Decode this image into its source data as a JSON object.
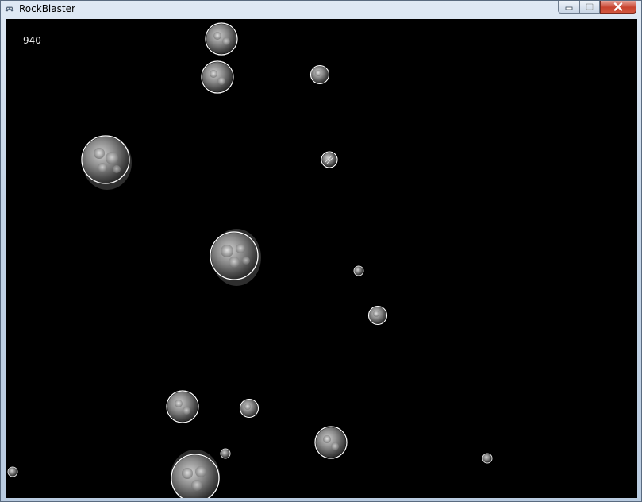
{
  "window": {
    "title": "RockBlaster",
    "icons": {
      "app": "gamepad-icon",
      "minimize": "minimize-icon",
      "maximize": "maximize-icon",
      "close": "close-icon"
    },
    "colors": {
      "close_button": "#c7432f",
      "game_background": "#000000",
      "rock_outline": "#ffffff"
    }
  },
  "game": {
    "score": "940"
  }
}
